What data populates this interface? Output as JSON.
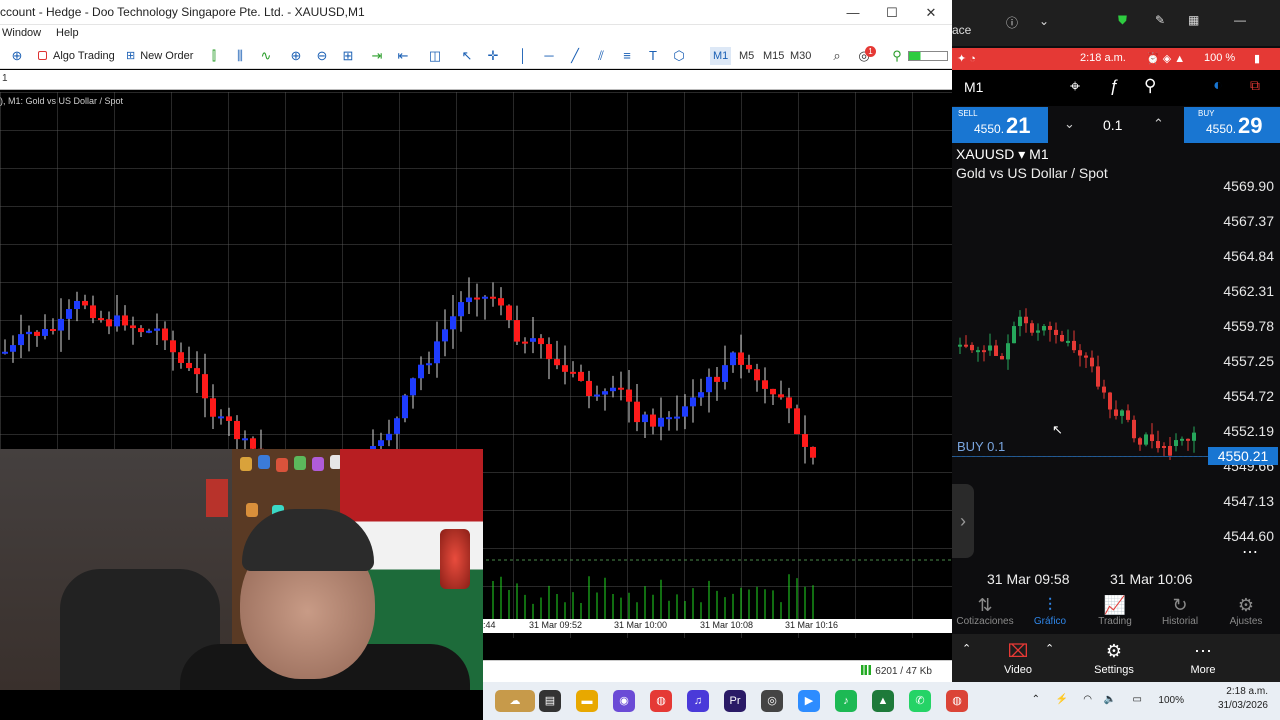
{
  "mt5": {
    "title": "ccount - Hedge - Doo Technology Singapore Pte. Ltd. - XAUUSD,M1",
    "menu": [
      "Window",
      "Help"
    ],
    "toolbar": {
      "algo_trading": "Algo Trading",
      "new_order": "New Order",
      "timeframes": [
        "M1",
        "M5",
        "M15",
        "M30"
      ],
      "active_timeframe": "M1",
      "notification_count": "1"
    },
    "tab_text": "1",
    "chart_label": "), M1:  Gold vs US Dollar / Spot",
    "time_axis": [
      ":44",
      "31 Mar 09:52",
      "31 Mar 10:00",
      "31 Mar 10:08",
      "31 Mar 10:16"
    ],
    "status_traffic": "6201 / 47 Kb",
    "colors": {
      "bull": "#1e3cff",
      "bear": "#ff1a1a",
      "grid": "#5a5a5a",
      "volume": "#22dd22"
    }
  },
  "phone": {
    "top_title": "ace",
    "status_time": "2:18 a.m.",
    "status_battery": "100 %",
    "timeframe": "M1",
    "header_icons": [
      "crosshair-icon",
      "function-icon",
      "objects-icon",
      "indicator-icon",
      "window-icon"
    ],
    "sell_label": "SELL",
    "sell_price_small": "4550.",
    "sell_price_big": "21",
    "buy_label": "BUY",
    "buy_price_small": "4550.",
    "buy_price_big": "29",
    "volume": "0.1",
    "symbol": "XAUUSD ▾ M1",
    "symbol_desc": "Gold vs US Dollar / Spot",
    "y_ticks": [
      "4569.90",
      "4567.37",
      "4564.84",
      "4562.31",
      "4559.78",
      "4557.25",
      "4554.72",
      "4552.19",
      "4549.66",
      "4547.13",
      "4544.60"
    ],
    "position_label": "BUY 0.1",
    "bid_price": "4550.21",
    "time_labels": [
      "31 Mar 09:58",
      "31 Mar 10:06"
    ],
    "tabs": [
      {
        "label": "Cotizaciones",
        "icon": "⇅"
      },
      {
        "label": "Gráfico",
        "icon": "⫶"
      },
      {
        "label": "Trading",
        "icon": "📈"
      },
      {
        "label": "Historial",
        "icon": "↻"
      },
      {
        "label": "Ajustes",
        "icon": "⚙"
      }
    ],
    "active_tab": "Gráfico",
    "scrcpy": {
      "video": "Video",
      "settings": "Settings",
      "more": "More"
    }
  },
  "taskbar": {
    "clock_time": "2:18 a.m.",
    "clock_date": "31/03/2026",
    "battery": "100%"
  }
}
